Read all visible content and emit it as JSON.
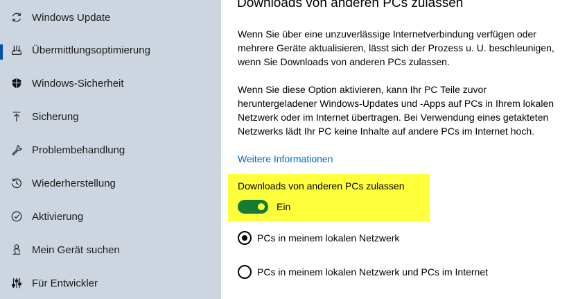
{
  "sidebar": {
    "items": [
      {
        "label": "Windows Update",
        "icon": "refresh-icon"
      },
      {
        "label": "Übermittlungsoptimierung",
        "icon": "delivery-optimization-icon",
        "selected": true
      },
      {
        "label": "Windows-Sicherheit",
        "icon": "shield-icon"
      },
      {
        "label": "Sicherung",
        "icon": "backup-arrow-icon"
      },
      {
        "label": "Problembehandlung",
        "icon": "wrench-icon"
      },
      {
        "label": "Wiederherstellung",
        "icon": "recovery-icon"
      },
      {
        "label": "Aktivierung",
        "icon": "check-circle-icon"
      },
      {
        "label": "Mein Gerät suchen",
        "icon": "person-locate-icon"
      },
      {
        "label": "Für Entwickler",
        "icon": "developer-sliders-icon"
      }
    ]
  },
  "main": {
    "title": "Downloads von anderen PCs zulassen",
    "paragraph1": "Wenn Sie über eine unzuverlässige Internetverbindung verfügen oder mehrere Geräte aktualisieren, lässt sich der Prozess u. U. beschleunigen, wenn Sie Downloads von anderen PCs zulassen.",
    "paragraph2": "Wenn Sie diese Option aktivieren, kann Ihr PC Teile zuvor heruntergeladener Windows-Updates und -Apps auf PCs in Ihrem lokalen Netzwerk oder im Internet übertragen. Bei Verwendung eines getakteten Netzwerks lädt Ihr PC keine Inhalte auf andere PCs im Internet hoch.",
    "link": "Weitere Informationen",
    "toggle": {
      "caption": "Downloads von anderen PCs zulassen",
      "state_label": "Ein",
      "on": true
    },
    "radios": [
      {
        "label": "PCs in meinem lokalen Netzwerk",
        "checked": true
      },
      {
        "label": "PCs in meinem lokalen Netzwerk und PCs im Internet",
        "checked": false
      }
    ]
  },
  "colors": {
    "sidebar_bg": "#cdd6e0",
    "accent": "#0050a8",
    "link": "#0067c0",
    "toggle_on": "#157a34",
    "highlight": "#ffff3c"
  }
}
